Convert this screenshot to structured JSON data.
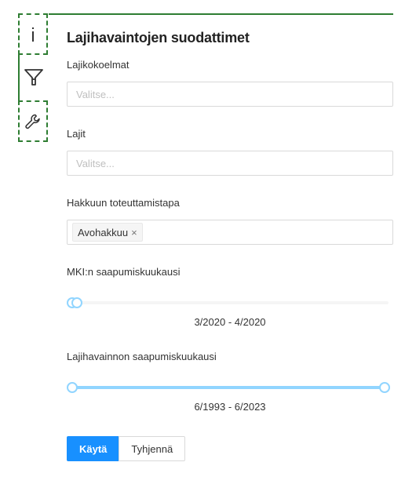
{
  "tabs": [
    {
      "icon": "info-icon"
    },
    {
      "icon": "filter-icon"
    },
    {
      "icon": "wrench-icon"
    }
  ],
  "panel": {
    "title": "Lajihavaintojen suodattimet"
  },
  "filters": {
    "collections": {
      "label": "Lajikokoelmat",
      "placeholder": "Valitse..."
    },
    "species": {
      "label": "Lajit",
      "placeholder": "Valitse..."
    },
    "harvest_method": {
      "label": "Hakkuun toteuttamistapa",
      "selected": [
        "Avohakkuu"
      ],
      "remove_symbol": "×"
    },
    "mki_month": {
      "label": "MKI:n saapumiskuukausi",
      "range_text": "3/2020 - 4/2020",
      "selected_fraction": [
        0.0,
        0.016
      ]
    },
    "observation_month": {
      "label": "Lajihavainnon saapumiskuukausi",
      "range_text": "6/1993 - 6/2023",
      "selected_fraction": [
        0.0,
        1.0
      ]
    }
  },
  "actions": {
    "apply_label": "Käytä",
    "clear_label": "Tyhjennä"
  },
  "colors": {
    "accent_green": "#2e7d32",
    "primary_blue": "#1890ff",
    "slider_blue": "#91d5ff"
  }
}
